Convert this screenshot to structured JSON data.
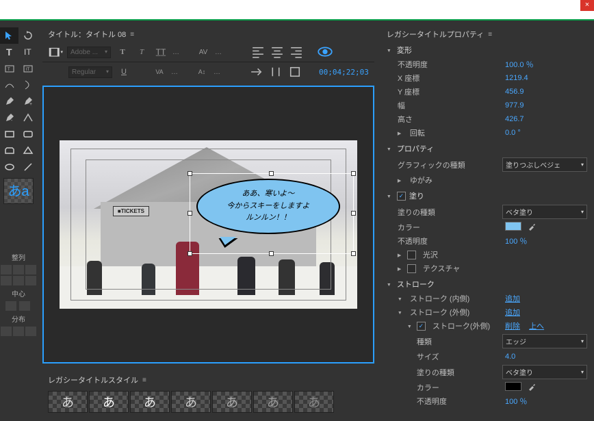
{
  "close_label": "×",
  "title_panel": {
    "label": "タイトル：タイトル 08"
  },
  "toolbar": {
    "font_family": "Adobe ...",
    "font_style": "Regular",
    "timecode": "00;04;22;03"
  },
  "canvas": {
    "sign_text": "■TICKETS",
    "bubble_line1": "ああ、寒いよ～",
    "bubble_line2": "今からスキーをしますよ",
    "bubble_line3": "ルンルン！！"
  },
  "styles_panel": {
    "label": "レガシータイトルスタイル"
  },
  "style_preview_text": "あa",
  "align_labels": {
    "align": "整列",
    "center": "中心",
    "distribute": "分布"
  },
  "props_panel": {
    "header": "レガシータイトルプロパティ",
    "transform": "変形",
    "opacity_label": "不透明度",
    "opacity_value": "100.0 ％",
    "xpos_label": "X 座標",
    "xpos_value": "1219.4",
    "ypos_label": "Y 座標",
    "ypos_value": "456.9",
    "width_label": "幅",
    "width_value": "977.9",
    "height_label": "高さ",
    "height_value": "426.7",
    "rotation_label": "回転",
    "rotation_value": "0.0 °",
    "property": "プロパティ",
    "graphic_type_label": "グラフィックの種類",
    "graphic_type_value": "塗りつぶしベジェ",
    "distort_label": "ゆがみ",
    "fill": "塗り",
    "fill_type_label": "塗りの種類",
    "fill_type_value": "ベタ塗り",
    "color_label": "カラー",
    "fill_opacity_label": "不透明度",
    "fill_opacity_value": "100 ％",
    "sheen_label": "光沢",
    "texture_label": "テクスチャ",
    "stroke": "ストローク",
    "stroke_inner": "ストローク (内側)",
    "stroke_outer": "ストローク (外側)",
    "stroke_outer_item": "ストローク(外側)",
    "add_label": "追加",
    "delete_label": "削除",
    "up_label": "上へ",
    "kind_label": "種類",
    "kind_value": "エッジ",
    "size_label": "サイズ",
    "size_value": "4.0",
    "stroke_fill_type_label": "塗りの種類",
    "stroke_fill_type_value": "ベタ塗り",
    "stroke_color_label": "カラー",
    "stroke_opacity_label": "不透明度",
    "stroke_opacity_value": "100 ％"
  }
}
